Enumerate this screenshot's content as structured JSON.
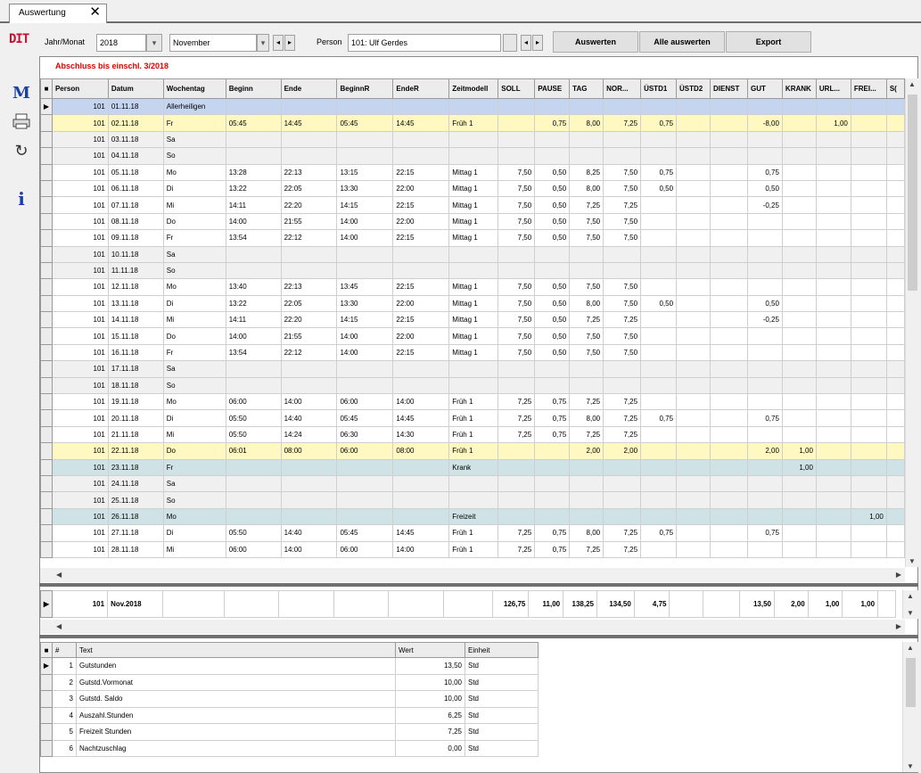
{
  "tab": {
    "label": "Auswertung",
    "close": "✕"
  },
  "logo": "DIT",
  "toolbar": {
    "jahrmonat_label": "Jahr/Monat",
    "year": "2018",
    "month": "November",
    "person_label": "Person",
    "person_value": "101: Ulf Gerdes",
    "btn_auswerten": "Auswerten",
    "btn_alle": "Alle auswerten",
    "btn_export": "Export"
  },
  "status": "Abschluss bis einschl. 3/2018",
  "grid": {
    "columns": [
      "Person",
      "Datum",
      "Wochentag",
      "Beginn",
      "Ende",
      "BeginnR",
      "EndeR",
      "Zeitmodell",
      "SOLL",
      "PAUSE",
      "TAG",
      "NOR...",
      "ÜSTD1",
      "ÜSTD2",
      "DIENST",
      "GUT",
      "KRANK",
      "URL...",
      "FREI...",
      "S("
    ],
    "rows": [
      {
        "t": "sel",
        "c": [
          "101",
          "01.11.18",
          "Allerheiligen",
          "",
          "",
          "",
          "",
          "",
          "",
          "",
          "",
          "",
          "",
          "",
          "",
          "",
          "",
          "",
          "",
          ""
        ]
      },
      {
        "t": "hl",
        "c": [
          "101",
          "02.11.18",
          "Fr",
          "05:45",
          "14:45",
          "05:45",
          "14:45",
          "Früh 1",
          "",
          "0,75",
          "8,00",
          "7,25",
          "0,75",
          "",
          "",
          "-8,00",
          "",
          "1,00",
          "",
          ""
        ]
      },
      {
        "t": "we",
        "c": [
          "101",
          "03.11.18",
          "Sa",
          "",
          "",
          "",
          "",
          "",
          "",
          "",
          "",
          "",
          "",
          "",
          "",
          "",
          "",
          "",
          "",
          ""
        ]
      },
      {
        "t": "we",
        "c": [
          "101",
          "04.11.18",
          "So",
          "",
          "",
          "",
          "",
          "",
          "",
          "",
          "",
          "",
          "",
          "",
          "",
          "",
          "",
          "",
          "",
          ""
        ]
      },
      {
        "t": "",
        "c": [
          "101",
          "05.11.18",
          "Mo",
          "13:28",
          "22:13",
          "13:15",
          "22:15",
          "Mittag 1",
          "7,50",
          "0,50",
          "8,25",
          "7,50",
          "0,75",
          "",
          "",
          "0,75",
          "",
          "",
          "",
          ""
        ]
      },
      {
        "t": "",
        "c": [
          "101",
          "06.11.18",
          "Di",
          "13:22",
          "22:05",
          "13:30",
          "22:00",
          "Mittag 1",
          "7,50",
          "0,50",
          "8,00",
          "7,50",
          "0,50",
          "",
          "",
          "0,50",
          "",
          "",
          "",
          ""
        ]
      },
      {
        "t": "",
        "c": [
          "101",
          "07.11.18",
          "Mi",
          "14:11",
          "22:20",
          "14:15",
          "22:15",
          "Mittag 1",
          "7,50",
          "0,50",
          "7,25",
          "7,25",
          "",
          "",
          "",
          "-0,25",
          "",
          "",
          "",
          ""
        ]
      },
      {
        "t": "",
        "c": [
          "101",
          "08.11.18",
          "Do",
          "14:00",
          "21:55",
          "14:00",
          "22:00",
          "Mittag 1",
          "7,50",
          "0,50",
          "7,50",
          "7,50",
          "",
          "",
          "",
          "",
          "",
          "",
          "",
          ""
        ]
      },
      {
        "t": "",
        "c": [
          "101",
          "09.11.18",
          "Fr",
          "13:54",
          "22:12",
          "14:00",
          "22:15",
          "Mittag 1",
          "7,50",
          "0,50",
          "7,50",
          "7,50",
          "",
          "",
          "",
          "",
          "",
          "",
          "",
          ""
        ]
      },
      {
        "t": "we",
        "c": [
          "101",
          "10.11.18",
          "Sa",
          "",
          "",
          "",
          "",
          "",
          "",
          "",
          "",
          "",
          "",
          "",
          "",
          "",
          "",
          "",
          "",
          ""
        ]
      },
      {
        "t": "we",
        "c": [
          "101",
          "11.11.18",
          "So",
          "",
          "",
          "",
          "",
          "",
          "",
          "",
          "",
          "",
          "",
          "",
          "",
          "",
          "",
          "",
          "",
          ""
        ]
      },
      {
        "t": "",
        "c": [
          "101",
          "12.11.18",
          "Mo",
          "13:40",
          "22:13",
          "13:45",
          "22:15",
          "Mittag 1",
          "7,50",
          "0,50",
          "7,50",
          "7,50",
          "",
          "",
          "",
          "",
          "",
          "",
          "",
          ""
        ]
      },
      {
        "t": "",
        "c": [
          "101",
          "13.11.18",
          "Di",
          "13:22",
          "22:05",
          "13:30",
          "22:00",
          "Mittag 1",
          "7,50",
          "0,50",
          "8,00",
          "7,50",
          "0,50",
          "",
          "",
          "0,50",
          "",
          "",
          "",
          ""
        ]
      },
      {
        "t": "",
        "c": [
          "101",
          "14.11.18",
          "Mi",
          "14:11",
          "22:20",
          "14:15",
          "22:15",
          "Mittag 1",
          "7,50",
          "0,50",
          "7,25",
          "7,25",
          "",
          "",
          "",
          "-0,25",
          "",
          "",
          "",
          ""
        ]
      },
      {
        "t": "",
        "c": [
          "101",
          "15.11.18",
          "Do",
          "14:00",
          "21:55",
          "14:00",
          "22:00",
          "Mittag 1",
          "7,50",
          "0,50",
          "7,50",
          "7,50",
          "",
          "",
          "",
          "",
          "",
          "",
          "",
          ""
        ]
      },
      {
        "t": "",
        "c": [
          "101",
          "16.11.18",
          "Fr",
          "13:54",
          "22:12",
          "14:00",
          "22:15",
          "Mittag 1",
          "7,50",
          "0,50",
          "7,50",
          "7,50",
          "",
          "",
          "",
          "",
          "",
          "",
          "",
          ""
        ]
      },
      {
        "t": "we",
        "c": [
          "101",
          "17.11.18",
          "Sa",
          "",
          "",
          "",
          "",
          "",
          "",
          "",
          "",
          "",
          "",
          "",
          "",
          "",
          "",
          "",
          "",
          ""
        ]
      },
      {
        "t": "we",
        "c": [
          "101",
          "18.11.18",
          "So",
          "",
          "",
          "",
          "",
          "",
          "",
          "",
          "",
          "",
          "",
          "",
          "",
          "",
          "",
          "",
          "",
          ""
        ]
      },
      {
        "t": "",
        "c": [
          "101",
          "19.11.18",
          "Mo",
          "06:00",
          "14:00",
          "06:00",
          "14:00",
          "Früh 1",
          "7,25",
          "0,75",
          "7,25",
          "7,25",
          "",
          "",
          "",
          "",
          "",
          "",
          "",
          ""
        ]
      },
      {
        "t": "",
        "c": [
          "101",
          "20.11.18",
          "Di",
          "05:50",
          "14:40",
          "05:45",
          "14:45",
          "Früh 1",
          "7,25",
          "0,75",
          "8,00",
          "7,25",
          "0,75",
          "",
          "",
          "0,75",
          "",
          "",
          "",
          ""
        ]
      },
      {
        "t": "",
        "c": [
          "101",
          "21.11.18",
          "Mi",
          "05:50",
          "14:24",
          "06:30",
          "14:30",
          "Früh 1",
          "7,25",
          "0,75",
          "7,25",
          "7,25",
          "",
          "",
          "",
          "",
          "",
          "",
          "",
          ""
        ]
      },
      {
        "t": "hl",
        "c": [
          "101",
          "22.11.18",
          "Do",
          "06:01",
          "08:00",
          "06:00",
          "08:00",
          "Früh 1",
          "",
          "",
          "2,00",
          "2,00",
          "",
          "",
          "",
          "2,00",
          "1,00",
          "",
          "",
          ""
        ]
      },
      {
        "t": "bl",
        "c": [
          "101",
          "23.11.18",
          "Fr",
          "",
          "",
          "",
          "",
          "Krank",
          "",
          "",
          "",
          "",
          "",
          "",
          "",
          "",
          "1,00",
          "",
          "",
          ""
        ]
      },
      {
        "t": "we",
        "c": [
          "101",
          "24.11.18",
          "Sa",
          "",
          "",
          "",
          "",
          "",
          "",
          "",
          "",
          "",
          "",
          "",
          "",
          "",
          "",
          "",
          "",
          ""
        ]
      },
      {
        "t": "we",
        "c": [
          "101",
          "25.11.18",
          "So",
          "",
          "",
          "",
          "",
          "",
          "",
          "",
          "",
          "",
          "",
          "",
          "",
          "",
          "",
          "",
          "",
          ""
        ]
      },
      {
        "t": "bl",
        "c": [
          "101",
          "26.11.18",
          "Mo",
          "",
          "",
          "",
          "",
          "Freizeit",
          "",
          "",
          "",
          "",
          "",
          "",
          "",
          "",
          "",
          "",
          "1,00",
          ""
        ]
      },
      {
        "t": "",
        "c": [
          "101",
          "27.11.18",
          "Di",
          "05:50",
          "14:40",
          "05:45",
          "14:45",
          "Früh 1",
          "7,25",
          "0,75",
          "8,00",
          "7,25",
          "0,75",
          "",
          "",
          "0,75",
          "",
          "",
          "",
          ""
        ]
      },
      {
        "t": "",
        "c": [
          "101",
          "28.11.18",
          "Mi",
          "06:00",
          "14:00",
          "06:00",
          "14:00",
          "Früh 1",
          "7,25",
          "0,75",
          "7,25",
          "7,25",
          "",
          "",
          "",
          "",
          "",
          "",
          "",
          ""
        ]
      }
    ],
    "summary": [
      "101",
      "Nov.2018",
      "",
      "",
      "",
      "",
      "",
      "",
      "126,75",
      "11,00",
      "138,25",
      "134,50",
      "4,75",
      "",
      "",
      "13,50",
      "2,00",
      "1,00",
      "1,00",
      ""
    ]
  },
  "bottom": {
    "columns": [
      "#",
      "Text",
      "Wert",
      "Einheit"
    ],
    "rows": [
      [
        "1",
        "Gutstunden",
        "13,50",
        "Std"
      ],
      [
        "2",
        "Gutstd.Vormonat",
        "10,00",
        "Std"
      ],
      [
        "3",
        "Gutstd. Saldo",
        "10,00",
        "Std"
      ],
      [
        "4",
        "Auszahl.Stunden",
        "6,25",
        "Std"
      ],
      [
        "5",
        "Freizeit Stunden",
        "7,25",
        "Std"
      ],
      [
        "6",
        "Nachtzuschlag",
        "0,00",
        "Std"
      ]
    ]
  },
  "colors": {
    "status": "#e00000",
    "selected": "#c5d5f0",
    "highlight": "#fff8c0",
    "absence": "#cfe3e6",
    "logo": "#c8102e"
  }
}
